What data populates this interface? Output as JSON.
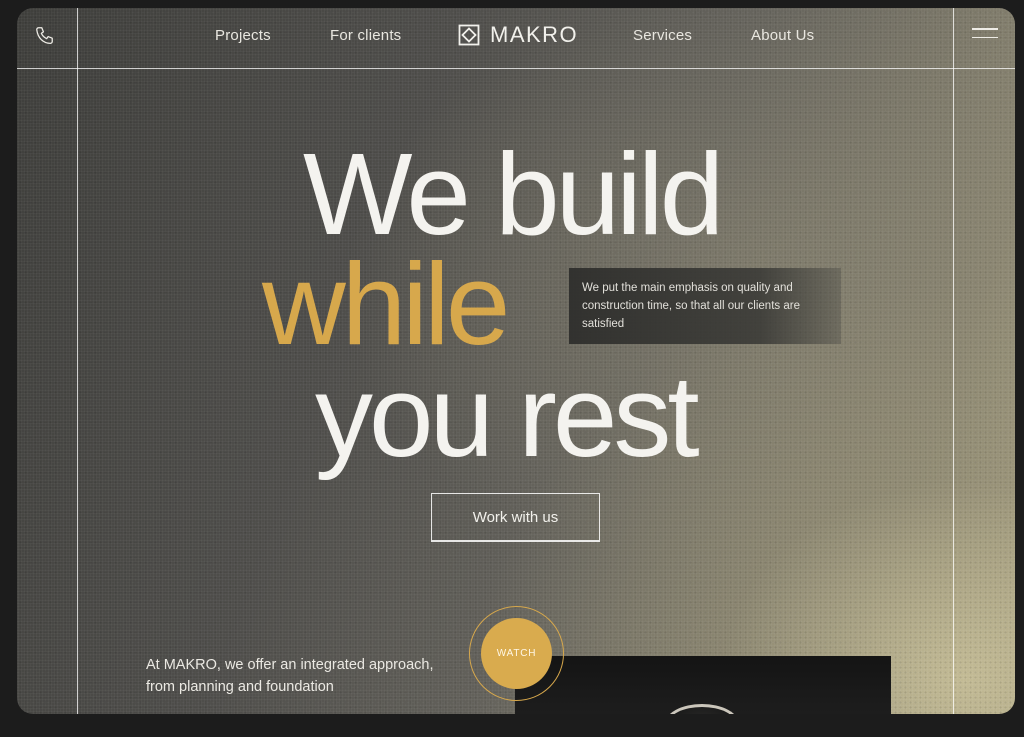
{
  "nav": {
    "left_links": [
      "Projects",
      "For clients"
    ],
    "right_links": [
      "Services",
      "About Us"
    ],
    "logo_text": "MAKRO",
    "phone_icon": "phone-icon",
    "menu_icon": "hamburger-menu-icon"
  },
  "hero": {
    "line1": "We build",
    "line2": "while",
    "line3": "you rest",
    "quote": "We put the main emphasis on quality and construction time, so that all our clients are satisfied",
    "cta_label": "Work with us"
  },
  "intro": {
    "text": "At MAKRO,  we offer an integrated approach, from planning and foundation"
  },
  "video": {
    "watch_label": "WATCH"
  },
  "colors": {
    "accent": "#d7a84c",
    "text_light": "#f4f3ef",
    "page_bg": "#1c1c1c"
  }
}
